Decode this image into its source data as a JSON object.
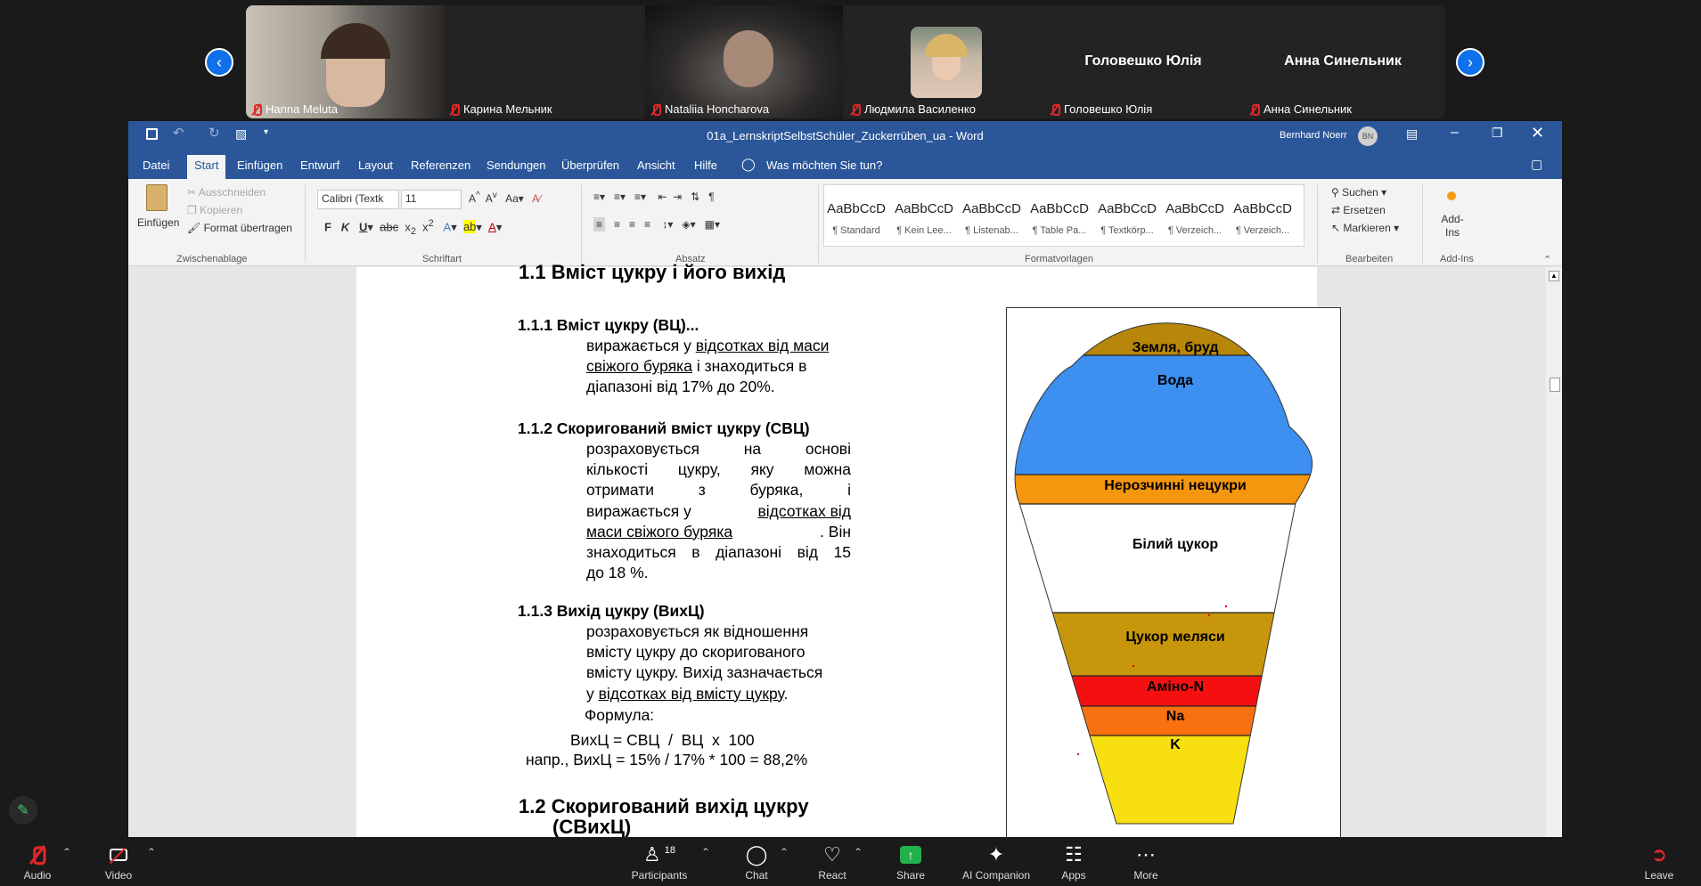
{
  "participants": [
    {
      "name": "Hanna Meluta",
      "video": true
    },
    {
      "name": "Карина Мельник",
      "video": false
    },
    {
      "name": "Nataliia Honcharova",
      "video": true
    },
    {
      "name": "Людмила Василенко",
      "video": false,
      "avatar": true
    },
    {
      "name": "Головешко Юлія",
      "video": false,
      "display_name": "Головешко Юлія"
    },
    {
      "name": "Анна Синельник",
      "video": false,
      "display_name": "Анна Синельник"
    }
  ],
  "word": {
    "title": "01a_LernskriptSelbstSchüler_Zuckerrüben_ua  -  Word",
    "user_name": "Bernhard Noerr",
    "user_initials": "BN",
    "tabs": [
      "Datei",
      "Start",
      "Einfügen",
      "Entwurf",
      "Layout",
      "Referenzen",
      "Sendungen",
      "Überprüfen",
      "Ansicht",
      "Hilfe"
    ],
    "active_tab": "Start",
    "tell_me": "Was möchten Sie tun?",
    "ribbon": {
      "paste": "Einfügen",
      "cut": "Ausschneiden",
      "copy": "Kopieren",
      "format_painter": "Format übertragen",
      "group_clipboard": "Zwischenablage",
      "font_name": "Calibri (Textk",
      "font_size": "11",
      "group_font": "Schriftart",
      "group_paragraph": "Absatz",
      "styles": [
        {
          "preview": "AaBbCcD",
          "name": "¶ Standard"
        },
        {
          "preview": "AaBbCcD",
          "name": "¶ Kein Lee..."
        },
        {
          "preview": "AaBbCcD",
          "name": "¶ Listenab..."
        },
        {
          "preview": "AaBbCcD",
          "name": "¶ Table Pa..."
        },
        {
          "preview": "AaBbCcD",
          "name": "¶ Textkörp..."
        },
        {
          "preview": "AaBbCcD",
          "name": "¶ Verzeich..."
        },
        {
          "preview": "AaBbCcD",
          "name": "¶ Verzeich..."
        }
      ],
      "group_styles": "Formatvorlagen",
      "find": "Suchen",
      "replace": "Ersetzen",
      "select": "Markieren",
      "group_editing": "Bearbeiten",
      "addins": "Add-Ins",
      "group_addins": "Add-Ins"
    },
    "document": {
      "h1_1": "1.1 Вміст цукру і його вихід",
      "s111_title": "1.1.1 Вміст цукру (ВЦ)...",
      "s111_l1a": "виражається у ",
      "s111_l1b": "відсотках від маси",
      "s111_l2a": "свіжого буряка",
      "s111_l2b": " і знаходиться в",
      "s111_l3": "діапазоні від 17% до 20%.",
      "s112_title": "1.1.2 Скоригований вміст цукру (СВЦ)",
      "s112_l1": "розраховується на основі",
      "s112_l2": "кількості цукру, яку можна",
      "s112_l3": "отримати з буряка, і",
      "s112_l4a": "виражається у ",
      "s112_l4b": "відсотках від",
      "s112_l5a": "маси свіжого буряка",
      "s112_l5b": ". Він",
      "s112_l6": "знаходиться в діапазоні від 15",
      "s112_l7": "до 18 %.",
      "s113_title": "1.1.3 Вихід цукру (ВихЦ)",
      "s113_l1": "розраховується як відношення",
      "s113_l2": "вмісту цукру до скоригованого",
      "s113_l3": "вмісту цукру. Вихід зазначається",
      "s113_l4a": "у ",
      "s113_l4b": "відсотках від вмісту цукру",
      "s113_l4c": ".",
      "formula_label": "Формула:",
      "formula": "ВихЦ = СВЦ  /  ВЦ  x  100",
      "formula_example": "напр., ВихЦ = 15% / 17% * 100 = 88,2%",
      "h1_2a": "1.2 Скоригований вихід цукру",
      "h1_2b": "(СВихЦ)"
    },
    "diagram": {
      "layers": [
        {
          "label": "Земля, бруд",
          "color": "#b8860b"
        },
        {
          "label": "Вода",
          "color": "#3d8ff0"
        },
        {
          "label": "Нерозчинні нецукри",
          "color": "#f5960f"
        },
        {
          "label": "Білий цукор",
          "color": "#ffffff"
        },
        {
          "label": "Цукор меляси",
          "color": "#c8960a"
        },
        {
          "label": "Аміно-N",
          "color": "#f41010"
        },
        {
          "label": "Na",
          "color": "#f87010"
        },
        {
          "label": "K",
          "color": "#f8e010"
        }
      ]
    }
  },
  "toolbar": {
    "audio": "Audio",
    "video": "Video",
    "participants": "Participants",
    "participants_count": "18",
    "chat": "Chat",
    "react": "React",
    "share": "Share",
    "ai": "AI Companion",
    "apps": "Apps",
    "more": "More",
    "leave": "Leave"
  }
}
